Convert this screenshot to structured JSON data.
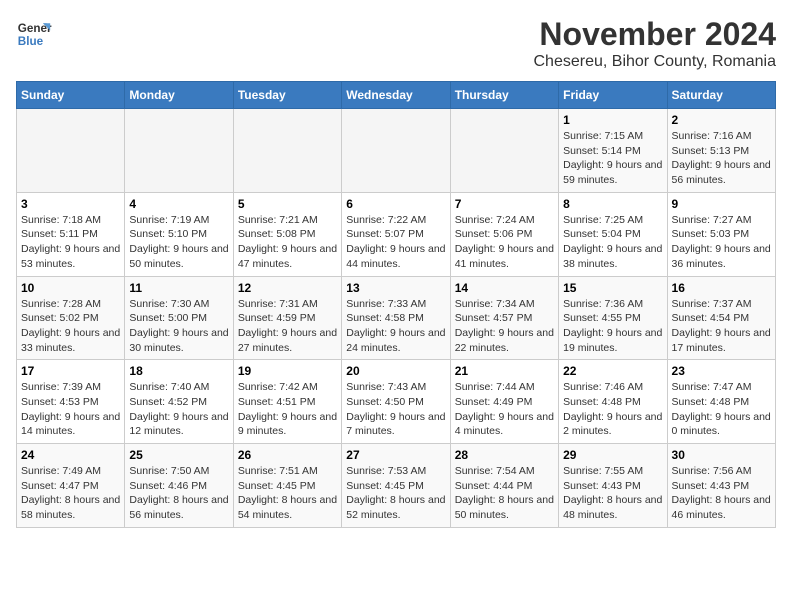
{
  "app": {
    "name_line1": "General",
    "name_line2": "Blue"
  },
  "title": "November 2024",
  "subtitle": "Chesereu, Bihor County, Romania",
  "days_of_week": [
    "Sunday",
    "Monday",
    "Tuesday",
    "Wednesday",
    "Thursday",
    "Friday",
    "Saturday"
  ],
  "weeks": [
    [
      {
        "day": "",
        "info": ""
      },
      {
        "day": "",
        "info": ""
      },
      {
        "day": "",
        "info": ""
      },
      {
        "day": "",
        "info": ""
      },
      {
        "day": "",
        "info": ""
      },
      {
        "day": "1",
        "info": "Sunrise: 7:15 AM\nSunset: 5:14 PM\nDaylight: 9 hours and 59 minutes."
      },
      {
        "day": "2",
        "info": "Sunrise: 7:16 AM\nSunset: 5:13 PM\nDaylight: 9 hours and 56 minutes."
      }
    ],
    [
      {
        "day": "3",
        "info": "Sunrise: 7:18 AM\nSunset: 5:11 PM\nDaylight: 9 hours and 53 minutes."
      },
      {
        "day": "4",
        "info": "Sunrise: 7:19 AM\nSunset: 5:10 PM\nDaylight: 9 hours and 50 minutes."
      },
      {
        "day": "5",
        "info": "Sunrise: 7:21 AM\nSunset: 5:08 PM\nDaylight: 9 hours and 47 minutes."
      },
      {
        "day": "6",
        "info": "Sunrise: 7:22 AM\nSunset: 5:07 PM\nDaylight: 9 hours and 44 minutes."
      },
      {
        "day": "7",
        "info": "Sunrise: 7:24 AM\nSunset: 5:06 PM\nDaylight: 9 hours and 41 minutes."
      },
      {
        "day": "8",
        "info": "Sunrise: 7:25 AM\nSunset: 5:04 PM\nDaylight: 9 hours and 38 minutes."
      },
      {
        "day": "9",
        "info": "Sunrise: 7:27 AM\nSunset: 5:03 PM\nDaylight: 9 hours and 36 minutes."
      }
    ],
    [
      {
        "day": "10",
        "info": "Sunrise: 7:28 AM\nSunset: 5:02 PM\nDaylight: 9 hours and 33 minutes."
      },
      {
        "day": "11",
        "info": "Sunrise: 7:30 AM\nSunset: 5:00 PM\nDaylight: 9 hours and 30 minutes."
      },
      {
        "day": "12",
        "info": "Sunrise: 7:31 AM\nSunset: 4:59 PM\nDaylight: 9 hours and 27 minutes."
      },
      {
        "day": "13",
        "info": "Sunrise: 7:33 AM\nSunset: 4:58 PM\nDaylight: 9 hours and 24 minutes."
      },
      {
        "day": "14",
        "info": "Sunrise: 7:34 AM\nSunset: 4:57 PM\nDaylight: 9 hours and 22 minutes."
      },
      {
        "day": "15",
        "info": "Sunrise: 7:36 AM\nSunset: 4:55 PM\nDaylight: 9 hours and 19 minutes."
      },
      {
        "day": "16",
        "info": "Sunrise: 7:37 AM\nSunset: 4:54 PM\nDaylight: 9 hours and 17 minutes."
      }
    ],
    [
      {
        "day": "17",
        "info": "Sunrise: 7:39 AM\nSunset: 4:53 PM\nDaylight: 9 hours and 14 minutes."
      },
      {
        "day": "18",
        "info": "Sunrise: 7:40 AM\nSunset: 4:52 PM\nDaylight: 9 hours and 12 minutes."
      },
      {
        "day": "19",
        "info": "Sunrise: 7:42 AM\nSunset: 4:51 PM\nDaylight: 9 hours and 9 minutes."
      },
      {
        "day": "20",
        "info": "Sunrise: 7:43 AM\nSunset: 4:50 PM\nDaylight: 9 hours and 7 minutes."
      },
      {
        "day": "21",
        "info": "Sunrise: 7:44 AM\nSunset: 4:49 PM\nDaylight: 9 hours and 4 minutes."
      },
      {
        "day": "22",
        "info": "Sunrise: 7:46 AM\nSunset: 4:48 PM\nDaylight: 9 hours and 2 minutes."
      },
      {
        "day": "23",
        "info": "Sunrise: 7:47 AM\nSunset: 4:48 PM\nDaylight: 9 hours and 0 minutes."
      }
    ],
    [
      {
        "day": "24",
        "info": "Sunrise: 7:49 AM\nSunset: 4:47 PM\nDaylight: 8 hours and 58 minutes."
      },
      {
        "day": "25",
        "info": "Sunrise: 7:50 AM\nSunset: 4:46 PM\nDaylight: 8 hours and 56 minutes."
      },
      {
        "day": "26",
        "info": "Sunrise: 7:51 AM\nSunset: 4:45 PM\nDaylight: 8 hours and 54 minutes."
      },
      {
        "day": "27",
        "info": "Sunrise: 7:53 AM\nSunset: 4:45 PM\nDaylight: 8 hours and 52 minutes."
      },
      {
        "day": "28",
        "info": "Sunrise: 7:54 AM\nSunset: 4:44 PM\nDaylight: 8 hours and 50 minutes."
      },
      {
        "day": "29",
        "info": "Sunrise: 7:55 AM\nSunset: 4:43 PM\nDaylight: 8 hours and 48 minutes."
      },
      {
        "day": "30",
        "info": "Sunrise: 7:56 AM\nSunset: 4:43 PM\nDaylight: 8 hours and 46 minutes."
      }
    ]
  ]
}
